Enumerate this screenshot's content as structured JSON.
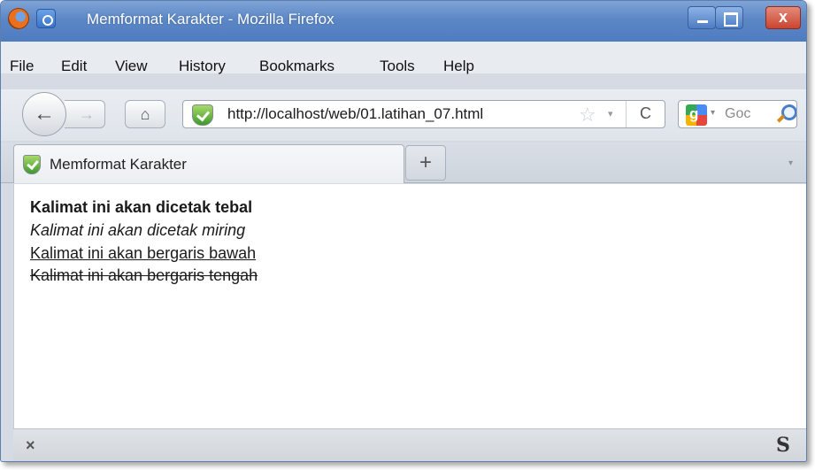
{
  "window": {
    "title": "Memformat Karakter - Mozilla Firefox",
    "close_label": "x"
  },
  "menubar": {
    "items": [
      "File",
      "Edit",
      "View",
      "History",
      "Bookmarks",
      "Tools",
      "Help"
    ]
  },
  "navbar": {
    "back_glyph": "←",
    "forward_glyph": "→",
    "home_glyph": "⌂",
    "url": "http://localhost/web/01.latihan_07.html",
    "star_glyph": "☆",
    "dropdown_glyph": "▾",
    "reload_glyph": "C",
    "search_engine_glyph": "g",
    "search_placeholder": "Goc"
  },
  "tabs": [
    {
      "title": "Memformat Karakter",
      "active": true
    }
  ],
  "newtab_glyph": "+",
  "tablist_glyph": "▾",
  "content": {
    "bold_line": "Kalimat ini akan dicetak tebal",
    "italic_line": "Kalimat ini akan dicetak miring",
    "underline_line": "Kalimat ini akan bergaris bawah",
    "strike_line": "Kalimat ini akan bergaris tengah"
  },
  "statusbar": {
    "close_glyph": "×",
    "addon_glyph": "S"
  },
  "colors": {
    "titlebar": "#5c87c6",
    "page_background": "#ffffff"
  }
}
